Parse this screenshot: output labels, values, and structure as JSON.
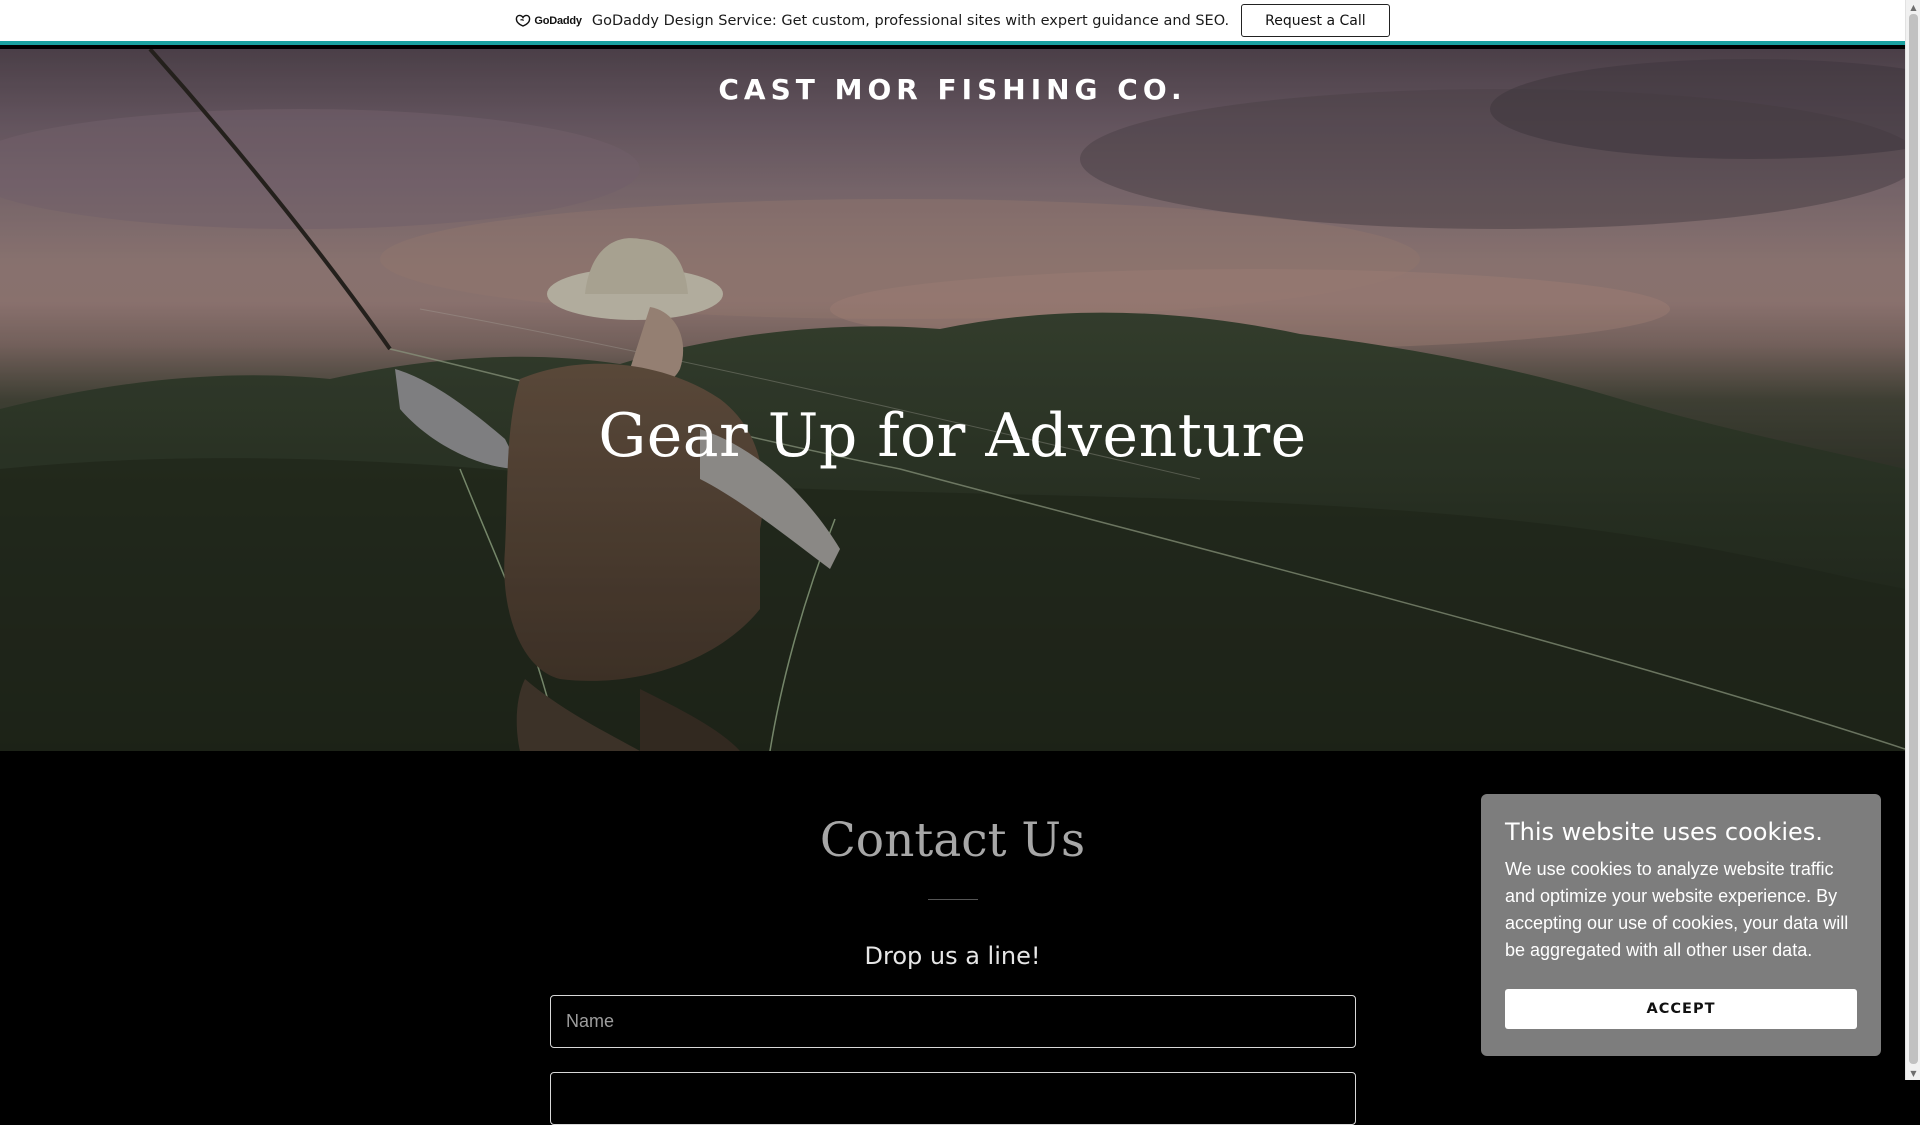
{
  "promo": {
    "logo_text": "GoDaddy",
    "message": "GoDaddy Design Service: Get custom, professional sites with expert guidance and SEO.",
    "button_label": "Request a Call",
    "accent_color": "#1aa1a0"
  },
  "hero": {
    "site_title": "CAST MOR FISHING CO.",
    "heading": "Gear Up for Adventure",
    "image_icon": "fly-fisherman-photo"
  },
  "contact": {
    "title": "Contact Us",
    "subtitle": "Drop us a line!",
    "name_placeholder": "Name",
    "email_placeholder": "",
    "name_value": "",
    "email_value": ""
  },
  "cookie_banner": {
    "title": "This website uses cookies.",
    "body": "We use cookies to analyze website traffic and optimize your website experience. By accepting our use of cookies, your data will be aggregated with all other user data.",
    "accept_label": "ACCEPT"
  },
  "colors": {
    "page_background": "#000000",
    "promo_background": "#ffffff",
    "cookie_background": "#7d7d7d"
  }
}
